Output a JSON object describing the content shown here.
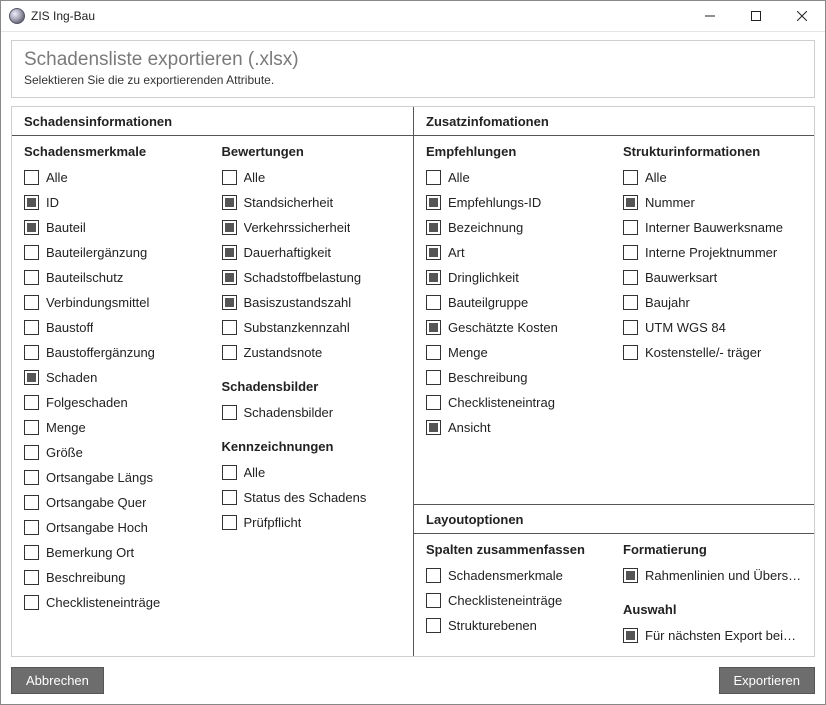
{
  "window": {
    "title": "ZIS Ing-Bau"
  },
  "header": {
    "title": "Schadensliste exportieren (.xlsx)",
    "subtitle": "Selektieren Sie die zu exportierenden Attribute."
  },
  "left": {
    "title": "Schadensinformationen",
    "groups": {
      "merkmale": {
        "title": "Schadensmerkmale",
        "items": [
          {
            "label": "Alle",
            "checked": false
          },
          {
            "label": "ID",
            "checked": true
          },
          {
            "label": "Bauteil",
            "checked": true
          },
          {
            "label": "Bauteilergänzung",
            "checked": false
          },
          {
            "label": "Bauteilschutz",
            "checked": false
          },
          {
            "label": "Verbindungsmittel",
            "checked": false
          },
          {
            "label": "Baustoff",
            "checked": false
          },
          {
            "label": "Baustoffergänzung",
            "checked": false
          },
          {
            "label": "Schaden",
            "checked": true
          },
          {
            "label": "Folgeschaden",
            "checked": false
          },
          {
            "label": "Menge",
            "checked": false
          },
          {
            "label": "Größe",
            "checked": false
          },
          {
            "label": "Ortsangabe Längs",
            "checked": false
          },
          {
            "label": "Ortsangabe Quer",
            "checked": false
          },
          {
            "label": "Ortsangabe Hoch",
            "checked": false
          },
          {
            "label": "Bemerkung Ort",
            "checked": false
          },
          {
            "label": "Beschreibung",
            "checked": false
          },
          {
            "label": "Checklisteneinträge",
            "checked": false
          }
        ]
      },
      "bewertungen": {
        "title": "Bewertungen",
        "items": [
          {
            "label": "Alle",
            "checked": false
          },
          {
            "label": "Standsicherheit",
            "checked": true
          },
          {
            "label": "Verkehrssicherheit",
            "checked": true
          },
          {
            "label": "Dauerhaftigkeit",
            "checked": true
          },
          {
            "label": "Schadstoffbelastung",
            "checked": true
          },
          {
            "label": "Basiszustandszahl",
            "checked": true
          },
          {
            "label": "Substanzkennzahl",
            "checked": false
          },
          {
            "label": "Zustandsnote",
            "checked": false
          }
        ]
      },
      "bilder": {
        "title": "Schadensbilder",
        "items": [
          {
            "label": "Schadensbilder",
            "checked": false
          }
        ]
      },
      "kennzeichnungen": {
        "title": "Kennzeichnungen",
        "items": [
          {
            "label": "Alle",
            "checked": false
          },
          {
            "label": "Status des Schadens",
            "checked": false
          },
          {
            "label": "Prüfpflicht",
            "checked": false
          }
        ]
      }
    }
  },
  "right": {
    "title": "Zusatzinfomationen",
    "groups": {
      "empfehlungen": {
        "title": "Empfehlungen",
        "items": [
          {
            "label": "Alle",
            "checked": false
          },
          {
            "label": "Empfehlungs-ID",
            "checked": true
          },
          {
            "label": "Bezeichnung",
            "checked": true
          },
          {
            "label": "Art",
            "checked": true
          },
          {
            "label": "Dringlichkeit",
            "checked": true
          },
          {
            "label": "Bauteilgruppe",
            "checked": false
          },
          {
            "label": "Geschätzte Kosten",
            "checked": true
          },
          {
            "label": "Menge",
            "checked": false
          },
          {
            "label": "Beschreibung",
            "checked": false
          },
          {
            "label": "Checklisteneintrag",
            "checked": false
          },
          {
            "label": "Ansicht",
            "checked": true
          }
        ]
      },
      "struktur": {
        "title": "Strukturinformationen",
        "items": [
          {
            "label": "Alle",
            "checked": false
          },
          {
            "label": "Nummer",
            "checked": true
          },
          {
            "label": "Interner Bauwerksname",
            "checked": false
          },
          {
            "label": "Interne Projektnummer",
            "checked": false
          },
          {
            "label": "Bauwerksart",
            "checked": false
          },
          {
            "label": "Baujahr",
            "checked": false
          },
          {
            "label": "UTM WGS 84",
            "checked": false
          },
          {
            "label": "Kostenstelle/- träger",
            "checked": false
          }
        ]
      }
    },
    "layout": {
      "title": "Layoutoptionen",
      "spalten": {
        "title": "Spalten zusammenfassen",
        "items": [
          {
            "label": "Schadensmerkmale",
            "checked": false
          },
          {
            "label": "Checklisteneinträge",
            "checked": false
          },
          {
            "label": "Strukturebenen",
            "checked": false
          }
        ]
      },
      "formatierung": {
        "title": "Formatierung",
        "items": [
          {
            "label": "Rahmenlinien und Überschrift",
            "checked": true
          }
        ]
      },
      "auswahl": {
        "title": "Auswahl",
        "items": [
          {
            "label": "Für nächsten Export beibehalten",
            "checked": true
          }
        ]
      }
    }
  },
  "footer": {
    "cancel": "Abbrechen",
    "export": "Exportieren"
  }
}
